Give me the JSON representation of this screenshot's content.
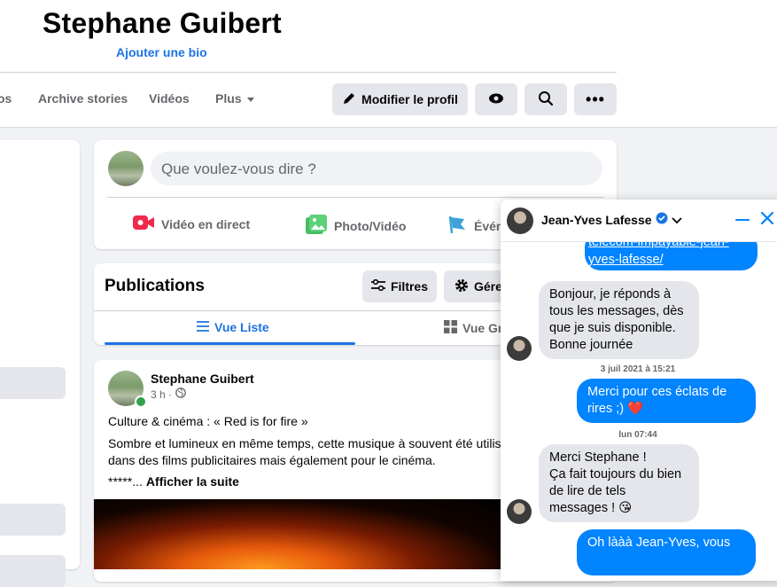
{
  "profile": {
    "name": "Stephane Guibert",
    "add_bio": "Ajouter une bio"
  },
  "nav": {
    "tabs": [
      "os",
      "Archive stories",
      "Vidéos",
      "Plus"
    ],
    "edit_profile": "Modifier le profil"
  },
  "composer": {
    "placeholder": "Que voulez-vous dire ?",
    "actions": [
      "Vidéo en direct",
      "Photo/Vidéo",
      "Évén"
    ]
  },
  "publications": {
    "title": "Publications",
    "filters": "Filtres",
    "manage": "Gére",
    "view_list": "Vue Liste",
    "view_grid": "Vue Gr"
  },
  "post": {
    "author": "Stephane Guibert",
    "time": "3 h ·",
    "line1": "Culture & cinéma : « Red is for fire »",
    "line2": "Sombre et lumineux en même temps, cette musique à souvent été utilis",
    "line3": "dans des films publicitaires mais également pour le cinéma.",
    "stars": "*****...",
    "see_more": "Afficher la suite"
  },
  "chat": {
    "contact": "Jean-Yves Lafesse",
    "link_line1": "telecom-impayable-jean-",
    "link_line2": "yves-lafesse/",
    "msg_in_1": [
      "Bonjour, je réponds à",
      "tous les messages, dès",
      "que je suis disponible.",
      "Bonne journée"
    ],
    "stamp1": "3 juil 2021 à 15:21",
    "msg_out_1": [
      "Merci pour ces éclats de",
      "rires ;) ❤️"
    ],
    "stamp2": "lun 07:44",
    "msg_in_2": [
      "Merci Stephane !",
      "Ça fait toujours du bien",
      "de lire de tels",
      "messages ! 😘"
    ],
    "msg_out_2": "Oh lààà Jean-Yves, vous"
  },
  "colors": {
    "accent": "#1b74e4",
    "messenger_blue": "#0084ff",
    "live_red": "#f02849",
    "photo_green": "#45bd62",
    "event_blue": "#3ea2d6"
  }
}
